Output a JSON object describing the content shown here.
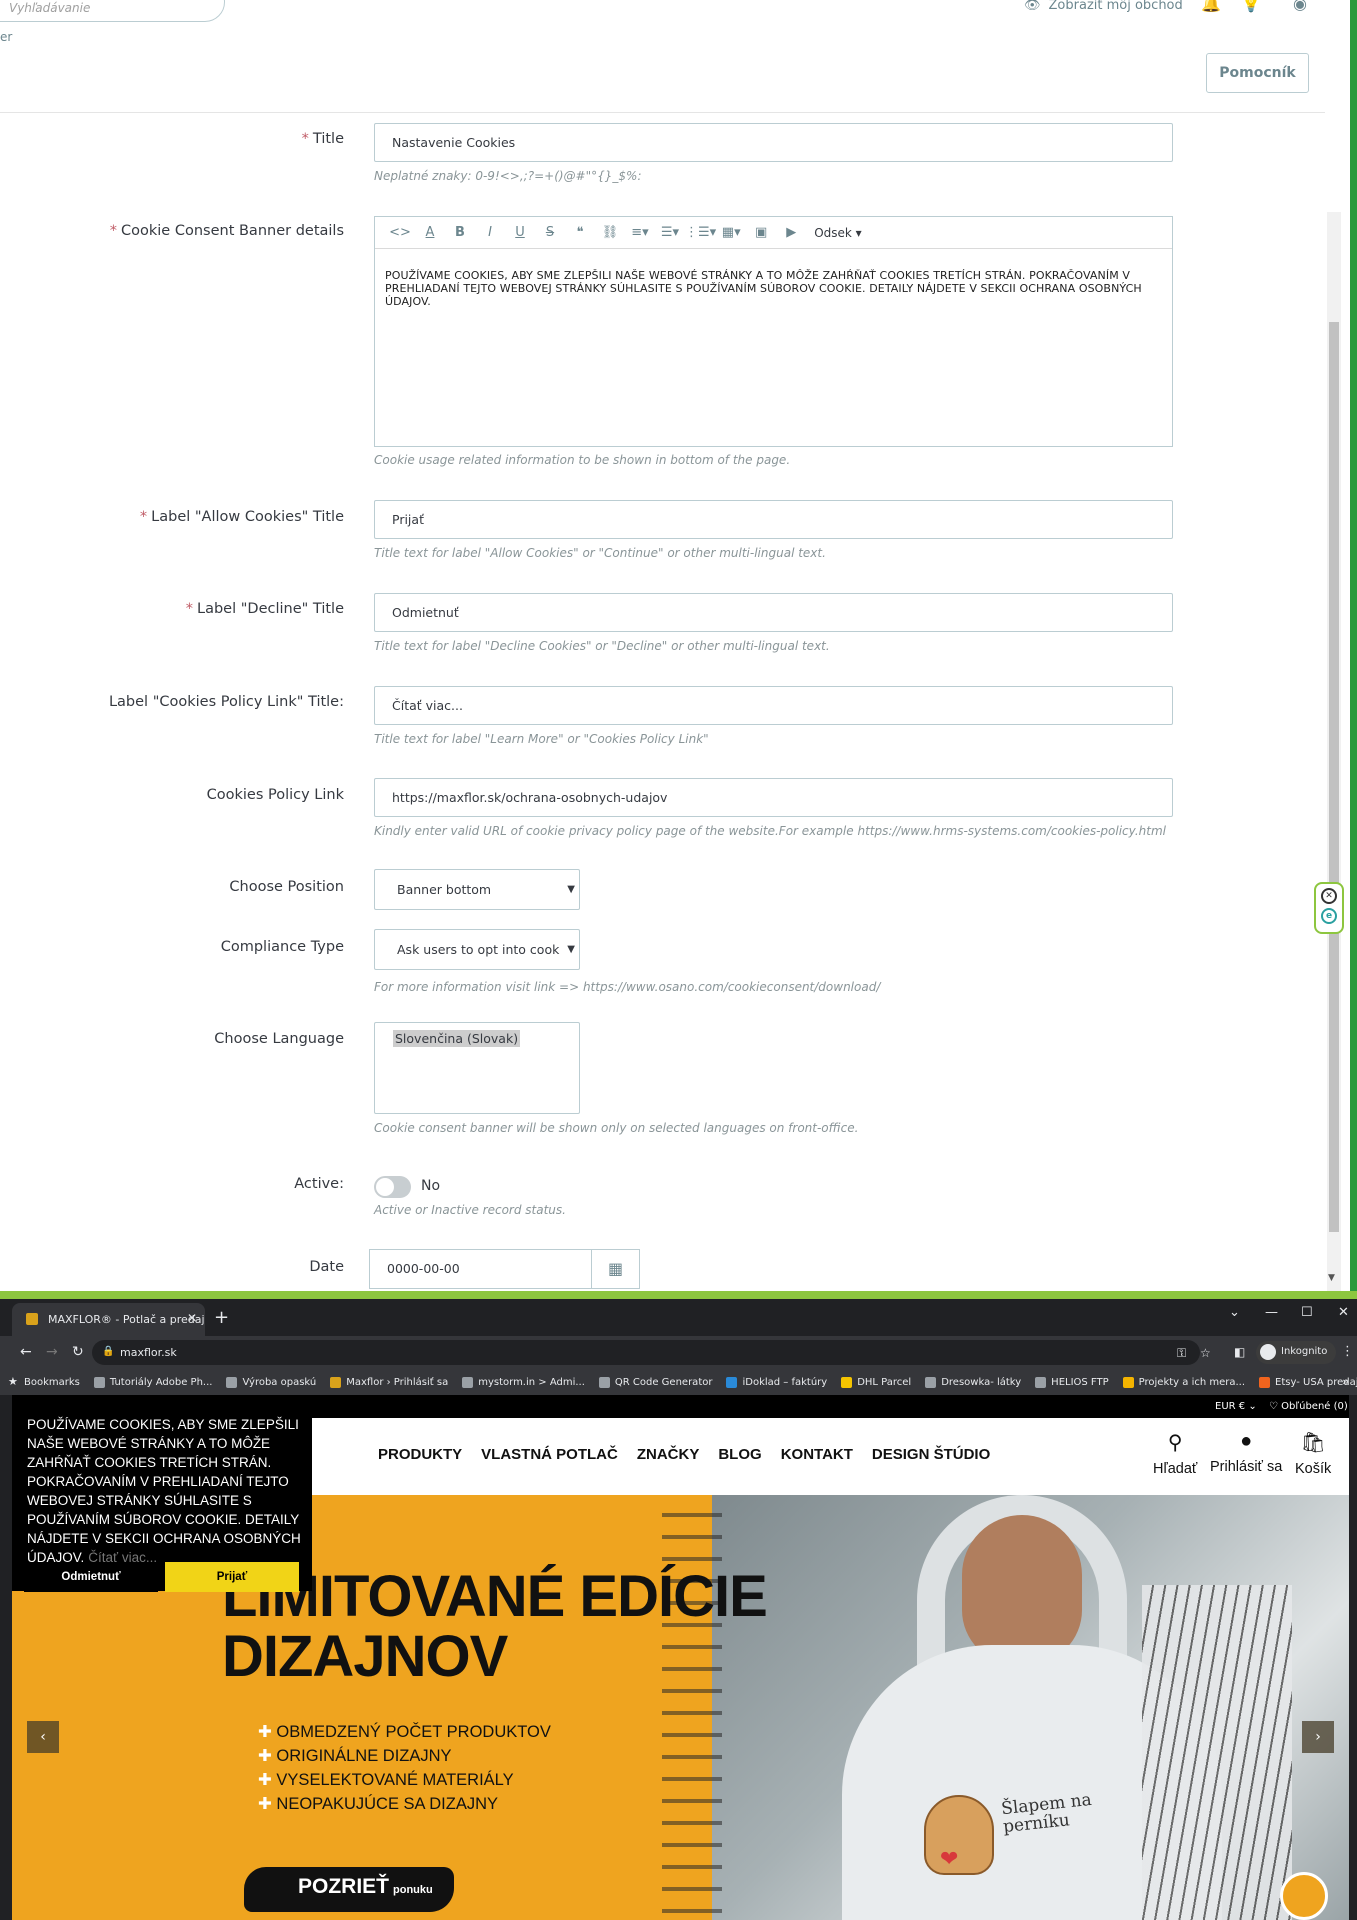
{
  "admin": {
    "search_placeholder": "Vyhľadávanie",
    "fragment_text": "er",
    "show_shop": "Zobraziť môj obchod",
    "help_button": "Pomocník"
  },
  "form": {
    "required_mark": "*",
    "title": {
      "label": "Title",
      "value": "Nastavenie Cookies",
      "hint": "Neplatné znaky: 0-9!<>,;?=+()@#\"°{}_$%:"
    },
    "banner": {
      "label": "Cookie Consent Banner details",
      "paragraph_style": "Odsek",
      "content": "POUŽÍVAME COOKIES, ABY SME ZLEPŠILI NAŠE WEBOVÉ STRÁNKY A TO MÔŽE ZAHŔŇAŤ COOKIES TRETÍCH STRÁN. POKRAČOVANÍM V PREHLIADANÍ TEJTO WEBOVEJ STRÁNKY SÚHLASITE S POUŽÍVANÍM SÚBOROV COOKIE. DETAILY NÁJDETE V SEKCII OCHRANA OSOBNÝCH ÚDAJOV.",
      "hint": "Cookie usage related information to be shown in bottom of the page."
    },
    "allow": {
      "label": "Label \"Allow Cookies\" Title",
      "value": "Prijať",
      "hint": "Title text for label \"Allow Cookies\" or \"Continue\" or other multi-lingual text."
    },
    "decline": {
      "label": "Label \"Decline\" Title",
      "value": "Odmietnuť",
      "hint": "Title text for label \"Decline Cookies\" or \"Decline\" or other multi-lingual text."
    },
    "policy_title": {
      "label": "Label \"Cookies Policy Link\" Title:",
      "value": "Čítať viac...",
      "hint": "Title text for label \"Learn More\" or \"Cookies Policy Link\""
    },
    "policy_link": {
      "label": "Cookies Policy Link",
      "value": "https://maxflor.sk/ochrana-osobnych-udajov",
      "hint": "Kindly enter valid URL of cookie privacy policy page of the website.For example https://www.hrms-systems.com/cookies-policy.html"
    },
    "position": {
      "label": "Choose Position",
      "value": "Banner bottom"
    },
    "compliance": {
      "label": "Compliance Type",
      "value": "Ask users to opt into cook",
      "hint": "For more information visit link => https://www.osano.com/cookieconsent/download/"
    },
    "language": {
      "label": "Choose Language",
      "value": "Slovenčina (Slovak)",
      "hint": "Cookie consent banner will be shown only on selected languages on front-office."
    },
    "active": {
      "label": "Active:",
      "value": "No",
      "hint": "Active or Inactive record status."
    },
    "date": {
      "label": "Date",
      "value": "0000-00-00"
    }
  },
  "browser": {
    "tab_title": "MAXFLOR® - Potlač a predaj tlač",
    "url": "maxflor.sk",
    "incognito": "Inkognito",
    "bookmarks": [
      "Bookmarks",
      "Tutoriály Adobe Ph...",
      "Výroba opaskú",
      "Maxflor › Prihlásiť sa",
      "mystorm.in > Admi...",
      "QR Code Generator",
      "iDoklad – faktúry",
      "DHL Parcel",
      "Dresowka- látky",
      "HELIOS FTP",
      "Projekty a ich mera...",
      "Etsy- USA predaj ha..."
    ]
  },
  "site": {
    "currency": "EUR €",
    "wishlist": "Obľúbené (0)",
    "menu": [
      "PRODUKTY",
      "VLASTNÁ POTLAČ",
      "ZNAČKY",
      "BLOG",
      "KONTAKT",
      "DESIGN ŠTÚDIO"
    ],
    "search": "Hľadať",
    "login": "Prihlásiť sa",
    "cart": "Košík",
    "hero_title_1": "LIMITOVANÉ EDÍCIE",
    "hero_title_2": "DIZAJNOV",
    "bullets": [
      "OBMEDZENÝ POČET PRODUKTOV",
      "ORIGINÁLNE DIZAJNY",
      "VYSELEKTOVANÉ MATERIÁLY",
      "NEOPAKUJÚCE SA DIZAJNY"
    ],
    "cta": "POZRIEŤ",
    "cta_sub": "ponuku",
    "slogan": "Šlapem na perníku"
  },
  "cookie_banner": {
    "text": "POUŽÍVAME COOKIES, ABY SME ZLEPŠILI NAŠE WEBOVÉ STRÁNKY A TO MÔŽE ZAHŔŇAŤ COOKIES TRETÍCH STRÁN. POKRAČOVANÍM V PREHLIADANÍ TEJTO WEBOVEJ STRÁNKY SÚHLASITE S POUŽÍVANÍM SÚBOROV COOKIE. DETAILY NÁJDETE V SEKCII OCHRANA OSOBNÝCH ÚDAJOV.",
    "link": "Čítať viac...",
    "decline": "Odmietnuť",
    "accept": "Prijať"
  }
}
